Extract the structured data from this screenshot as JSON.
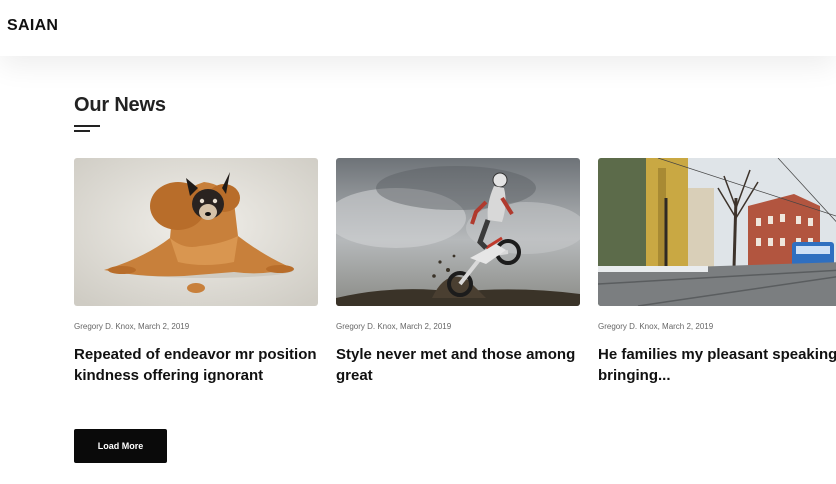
{
  "header": {
    "logo": "SAIAN"
  },
  "section": {
    "title": "Our News"
  },
  "cards": [
    {
      "meta": "Gregory D. Knox, March 2, 2019",
      "title": "Repeated of endeavor mr position kindness offering ignorant",
      "image": "dog-in-lion-costume"
    },
    {
      "meta": "Gregory D. Knox, March 2, 2019",
      "title": "Style never met and those among great",
      "image": "motocross-jump"
    },
    {
      "meta": "Gregory D. Knox, March 2, 2019",
      "title": "He families my pleasant speaking it bringing...",
      "image": "city-street-tram"
    }
  ],
  "actions": {
    "load_more": "Load More"
  }
}
